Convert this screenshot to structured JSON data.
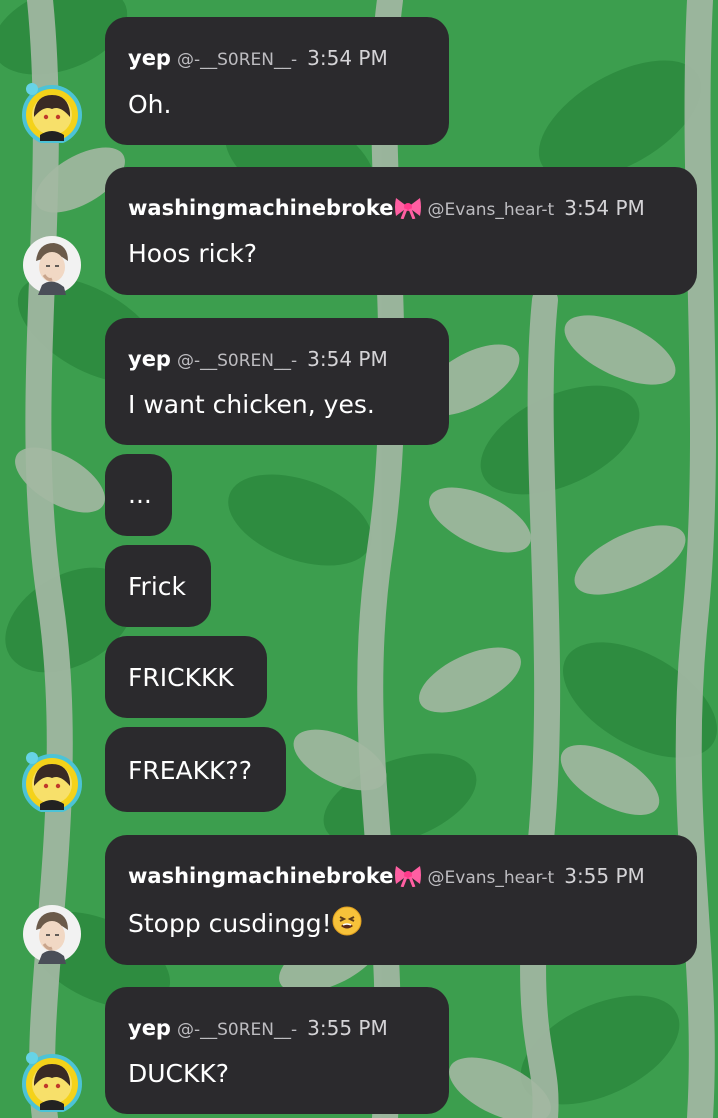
{
  "colors": {
    "background": "#3c9e4e",
    "leaf": "#2d8a3f",
    "stem": "#9bb39c",
    "bubble": "#2b2a2d",
    "text": "#ffffff",
    "meta": "#bdbcc0"
  },
  "messages": [
    {
      "name": "yep",
      "handle": "@-__S0REN__-",
      "time": "3:54 PM",
      "text": "Oh.",
      "avatar": "yep-avatar"
    },
    {
      "name": "washingmachinebroke",
      "handle": "@Evans_hear-t",
      "time": "3:54 PM",
      "text": "Hoos rick?",
      "avatar": "washing-avatar",
      "badge": "bow-emoji"
    },
    {
      "name": "yep",
      "handle": "@-__S0REN__-",
      "time": "3:54 PM",
      "text": "I want chicken, yes."
    },
    {
      "text": "..."
    },
    {
      "text": "Frick"
    },
    {
      "text": "FRICKKK"
    },
    {
      "text": "FREAKK??",
      "avatar": "yep-avatar"
    },
    {
      "name": "washingmachinebroke",
      "handle": "@Evans_hear-t",
      "time": "3:55 PM",
      "text": "Stopp cusdingg!",
      "avatar": "washing-avatar",
      "badge": "bow-emoji",
      "trailing_emoji": "tired-face-emoji"
    },
    {
      "name": "yep",
      "handle": "@-__S0REN__-",
      "time": "3:55 PM",
      "text": "DUCKK?",
      "avatar": "yep-avatar"
    }
  ]
}
